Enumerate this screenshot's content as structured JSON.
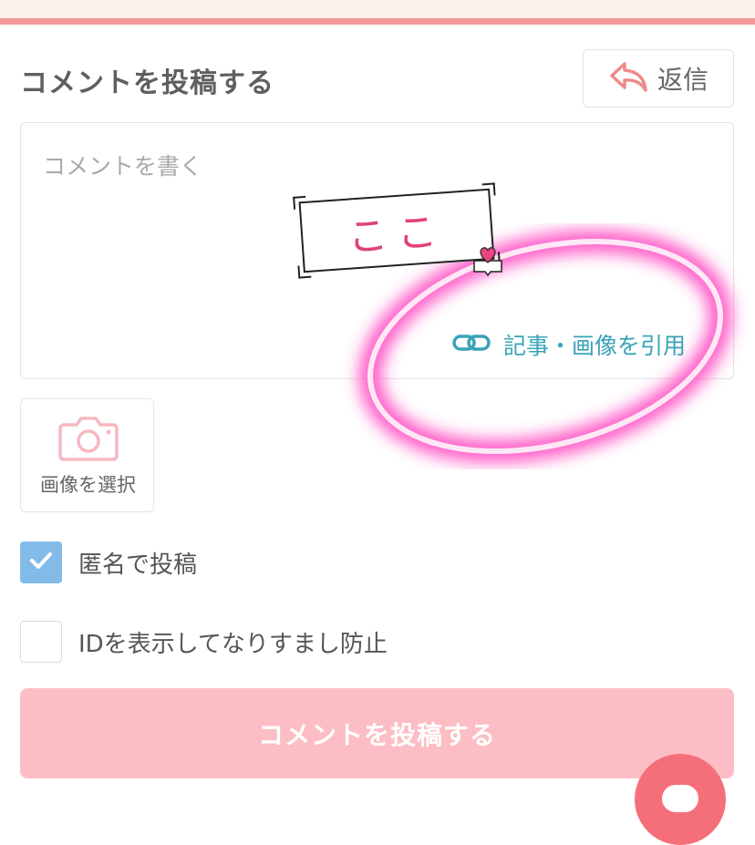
{
  "header": {
    "title": "コメントを投稿する",
    "reply_label": "返信"
  },
  "comment": {
    "placeholder": "コメントを書く",
    "quote_link": "記事・画像を引用"
  },
  "image_select": {
    "label": "画像を選択"
  },
  "options": [
    {
      "label": "匿名で投稿",
      "checked": true
    },
    {
      "label": "IDを表示してなりすまし防止",
      "checked": false
    }
  ],
  "submit_label": "コメントを投稿する",
  "annotation": {
    "label": "ここ"
  },
  "colors": {
    "accent_pink": "#f49a9a",
    "submit_bg": "#fcbec4",
    "link_teal": "#39a3b8",
    "check_blue": "#83bbe8",
    "fab": "#f56f7a",
    "highlight": "#ff3fbf"
  },
  "icons": [
    "reply-arrow-icon",
    "link-icon",
    "camera-icon",
    "check-icon",
    "chat-bubble-icon",
    "heart-icon"
  ]
}
